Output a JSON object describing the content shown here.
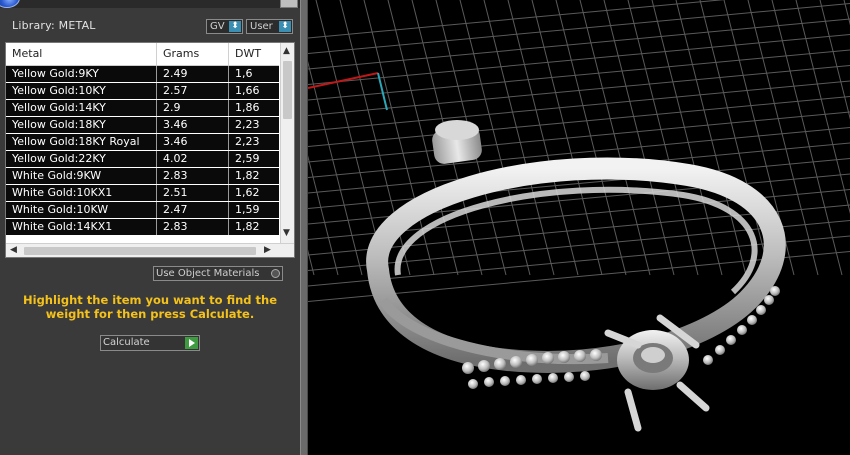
{
  "panel": {
    "library_label": "Library: METAL",
    "gv_select": "GV",
    "user_select": "User",
    "use_object_materials": "Use Object Materials",
    "instruction": "Highlight the item you want to find the weight for then press Calculate.",
    "calculate_label": "Calculate"
  },
  "table": {
    "columns": [
      "Metal",
      "Grams",
      "DWT"
    ],
    "rows": [
      [
        "Yellow Gold:9KY",
        "2.49",
        "1,6"
      ],
      [
        "Yellow Gold:10KY",
        "2.57",
        "1,66"
      ],
      [
        "Yellow Gold:14KY",
        "2.9",
        "1,86"
      ],
      [
        "Yellow Gold:18KY",
        "3.46",
        "2,23"
      ],
      [
        "Yellow Gold:18KY Royal",
        "3.46",
        "2,23"
      ],
      [
        "Yellow Gold:22KY",
        "4.02",
        "2,59"
      ],
      [
        "White Gold:9KW",
        "2.83",
        "1,82"
      ],
      [
        "White Gold:10KX1",
        "2.51",
        "1,62"
      ],
      [
        "White Gold:10KW",
        "2.47",
        "1,59"
      ],
      [
        "White Gold:14KX1",
        "2.83",
        "1,82"
      ]
    ]
  },
  "colors": {
    "instruction": "#f4c21a",
    "grid": "#5a5a5a",
    "axis_x": "#c01818",
    "axis_y": "#2aa8b8"
  }
}
